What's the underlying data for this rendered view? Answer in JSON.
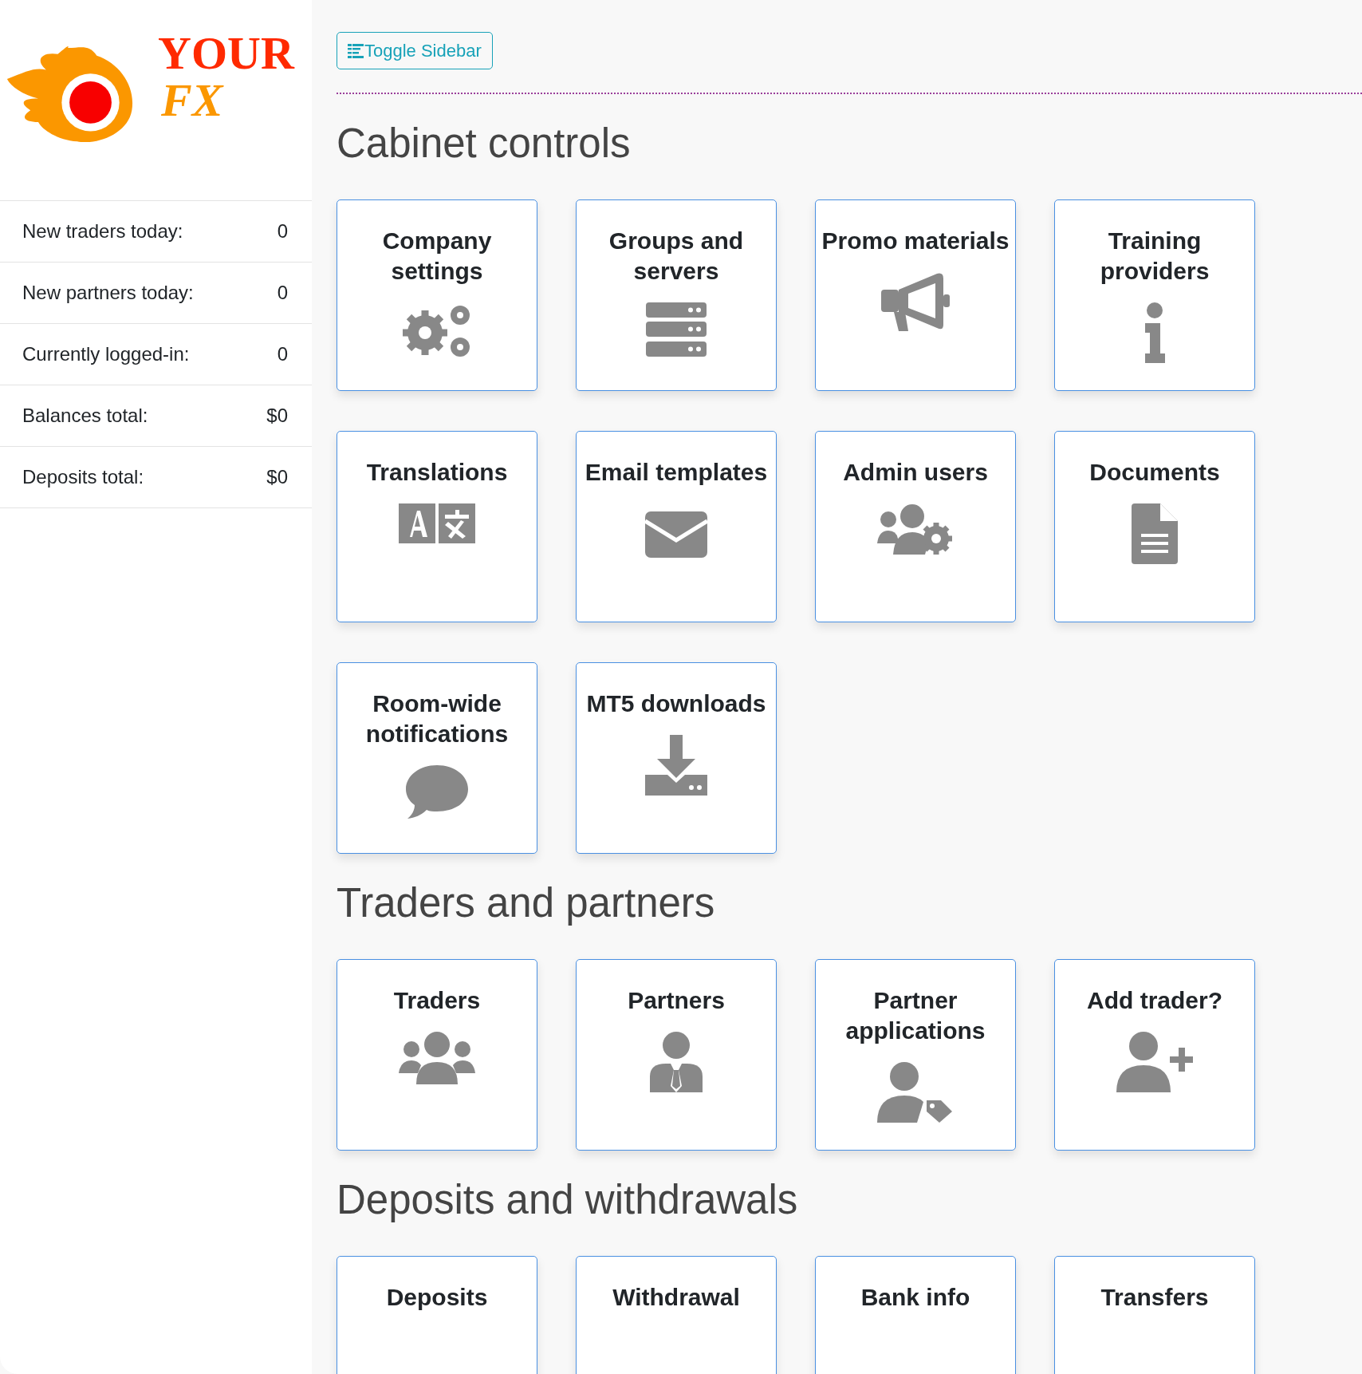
{
  "logo": {
    "line_1": "YOUR",
    "line_2": "FX"
  },
  "stats": [
    {
      "label": "New traders today:",
      "value": "0"
    },
    {
      "label": "New partners today:",
      "value": "0"
    },
    {
      "label": "Currently logged-in:",
      "value": "0"
    },
    {
      "label": "Balances total:",
      "value": "$0"
    },
    {
      "label": "Deposits total:",
      "value": "$0"
    }
  ],
  "toggle_button": "Toggle Sidebar",
  "sections": [
    {
      "title": "Cabinet controls",
      "cards": [
        {
          "title": "Company settings"
        },
        {
          "title": "Groups and servers"
        },
        {
          "title": "Promo materials"
        },
        {
          "title": "Training providers"
        },
        {
          "title": "Translations"
        },
        {
          "title": "Email templates"
        },
        {
          "title": "Admin users"
        },
        {
          "title": "Documents"
        },
        {
          "title": "Room-wide notifications"
        },
        {
          "title": "MT5 downloads"
        }
      ]
    },
    {
      "title": "Traders and partners",
      "cards": [
        {
          "title": "Traders"
        },
        {
          "title": "Partners"
        },
        {
          "title": "Partner applications"
        },
        {
          "title": "Add trader?"
        }
      ]
    },
    {
      "title": "Deposits and withdrawals",
      "cards": [
        {
          "title": "Deposits"
        },
        {
          "title": "Withdrawal"
        },
        {
          "title": "Bank info"
        },
        {
          "title": "Transfers"
        }
      ]
    }
  ]
}
